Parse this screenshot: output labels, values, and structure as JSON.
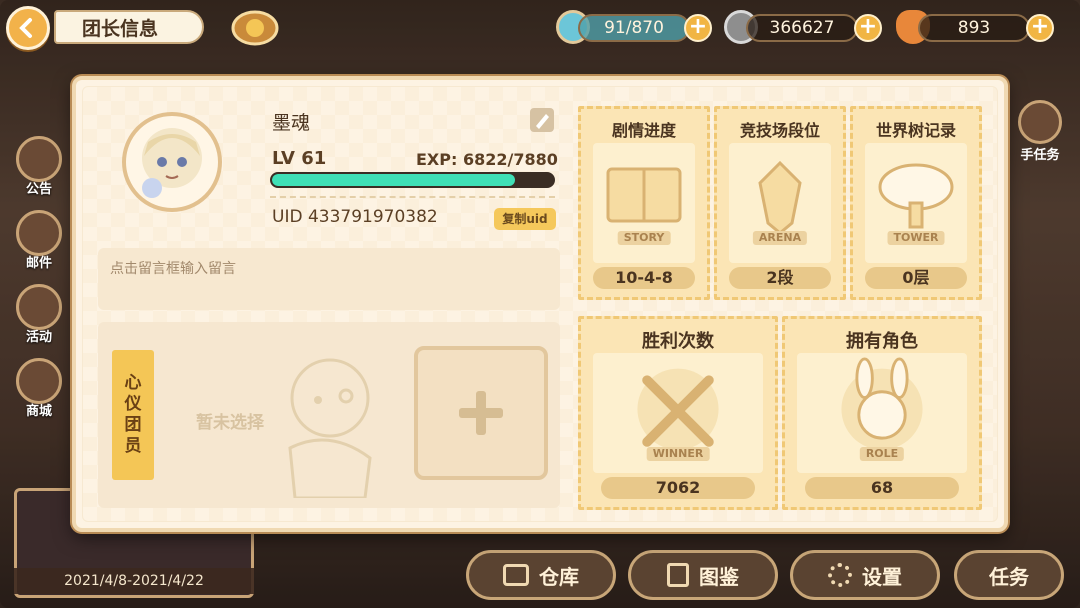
{
  "header": {
    "title": "团长信息"
  },
  "resources": [
    {
      "icon": "stamina-icon",
      "value": "91/870"
    },
    {
      "icon": "coin-icon",
      "value": "366627"
    },
    {
      "icon": "carrot-icon",
      "value": "893"
    }
  ],
  "side_menu": [
    "公告",
    "邮件",
    "活动",
    "商城"
  ],
  "right_hint": "手任务",
  "bottom": {
    "warehouse": "仓库",
    "collection": "图鉴",
    "settings": "设置",
    "tasks": "任务"
  },
  "event": {
    "date": "2021/4/8-2021/4/22"
  },
  "profile": {
    "name": "墨魂",
    "level": "LV 61",
    "exp": "EXP: 6822/7880",
    "exp_ratio": 0.866,
    "uid": "UID 433791970382",
    "copy_uid": "复制uid",
    "message_placeholder": "点击留言框输入留言"
  },
  "member": {
    "tag": [
      "心",
      "仪",
      "团",
      "员"
    ],
    "empty": "暂未选择"
  },
  "stats": {
    "story": {
      "title": "剧情进度",
      "label": "STORY",
      "value": "10-4-8"
    },
    "arena": {
      "title": "竞技场段位",
      "label": "ARENA",
      "value": "2段"
    },
    "tower": {
      "title": "世界树记录",
      "label": "TOWER",
      "value": "0层"
    },
    "wins": {
      "title": "胜利次数",
      "label": "WINNER",
      "value": "7062"
    },
    "roles": {
      "title": "拥有角色",
      "label": "ROLE",
      "value": "68"
    }
  },
  "colors": {
    "accent": "#f4c656",
    "exp_bar": "#3fe0b6",
    "panel": "#fdf3e3"
  }
}
